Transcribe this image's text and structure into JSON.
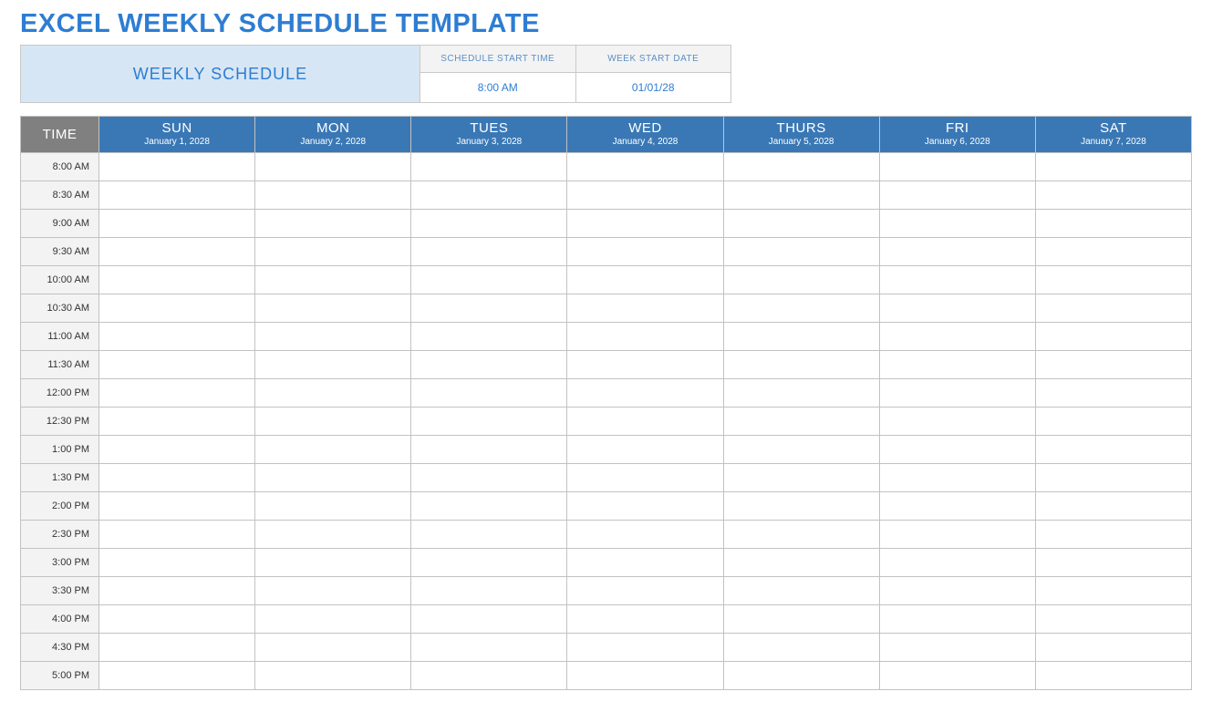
{
  "title": "EXCEL WEEKLY SCHEDULE TEMPLATE",
  "config": {
    "label": "WEEKLY SCHEDULE",
    "start_time_header": "SCHEDULE START TIME",
    "start_time_value": "8:00 AM",
    "start_date_header": "WEEK START DATE",
    "start_date_value": "01/01/28"
  },
  "time_column_header": "TIME",
  "days": [
    {
      "name": "SUN",
      "date": "January 1, 2028"
    },
    {
      "name": "MON",
      "date": "January 2, 2028"
    },
    {
      "name": "TUES",
      "date": "January 3, 2028"
    },
    {
      "name": "WED",
      "date": "January 4, 2028"
    },
    {
      "name": "THURS",
      "date": "January 5, 2028"
    },
    {
      "name": "FRI",
      "date": "January 6, 2028"
    },
    {
      "name": "SAT",
      "date": "January 7, 2028"
    }
  ],
  "times": [
    "8:00 AM",
    "8:30 AM",
    "9:00 AM",
    "9:30 AM",
    "10:00 AM",
    "10:30 AM",
    "11:00 AM",
    "11:30 AM",
    "12:00 PM",
    "12:30 PM",
    "1:00 PM",
    "1:30 PM",
    "2:00 PM",
    "2:30 PM",
    "3:00 PM",
    "3:30 PM",
    "4:00 PM",
    "4:30 PM",
    "5:00 PM"
  ]
}
